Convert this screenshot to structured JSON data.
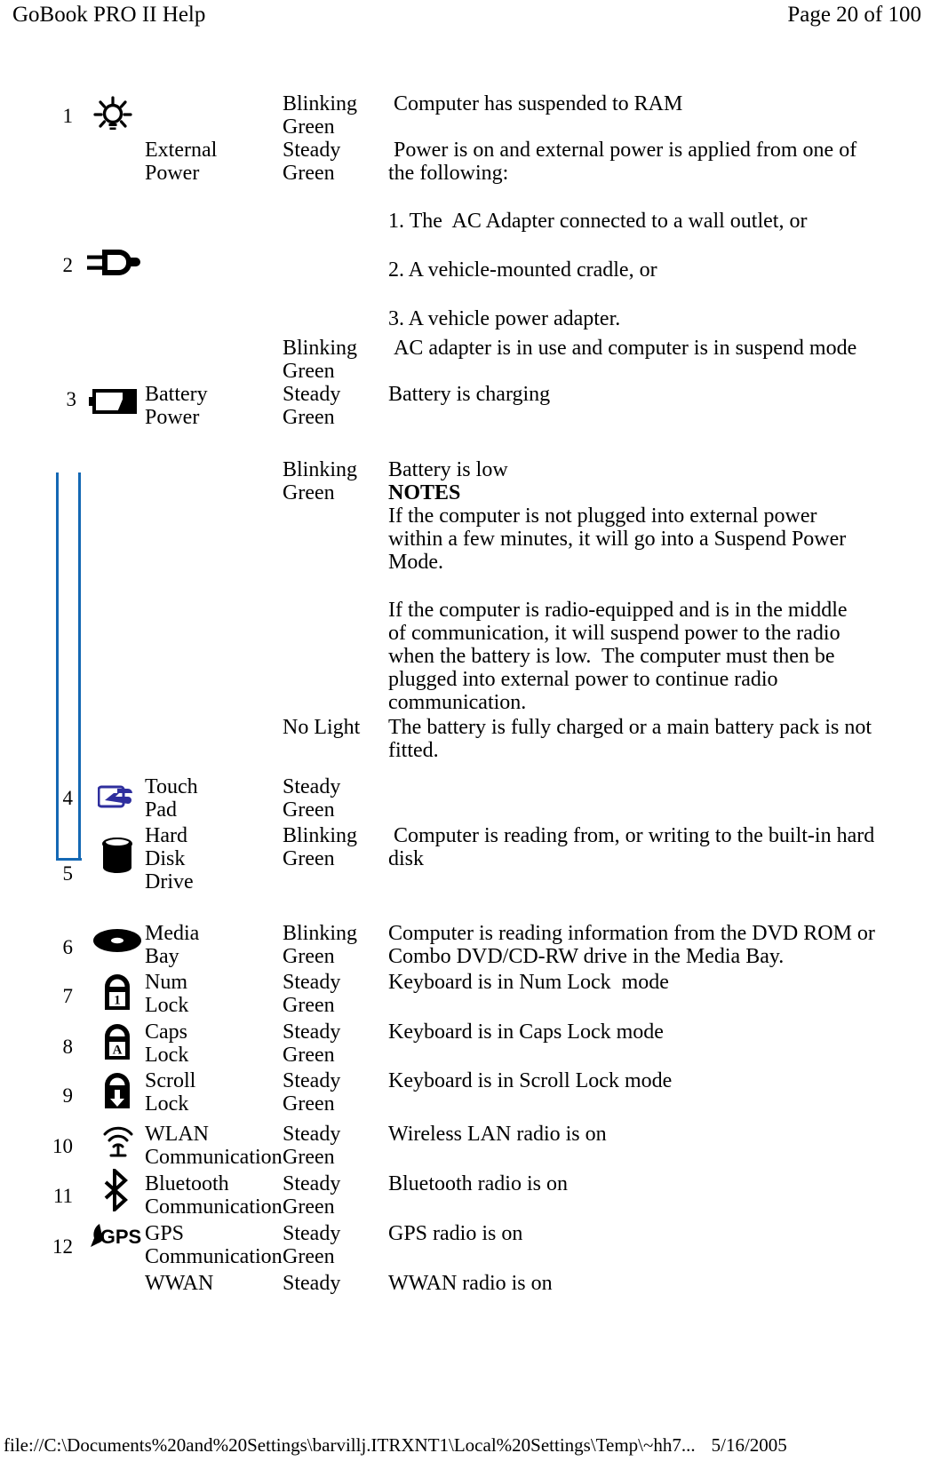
{
  "header": {
    "title": "GoBook PRO II Help",
    "page_label": "Page 20 of 100"
  },
  "footer": {
    "path": "file://C:\\Documents%20and%20Settings\\barvillj.ITRXNT1\\Local%20Settings\\Temp\\~hh7...",
    "date": "5/16/2005"
  },
  "table": {
    "rows": [
      {
        "number": "1",
        "icon": "power-light-icon",
        "label": "",
        "state": "Blinking\nGreen",
        "description": " Computer has suspended to RAM"
      },
      {
        "number": "",
        "icon": "",
        "label": "External\nPower",
        "state": "Steady\nGreen",
        "description": " Power is on and external power is applied from one of the following:"
      },
      {
        "number": "2",
        "icon": "power-plug-icon",
        "label": "",
        "state": "",
        "description": "1. The  AC Adapter connected to a wall outlet, or"
      },
      {
        "number": "",
        "icon": "",
        "label": "",
        "state": "",
        "description": "2. A vehicle-mounted cradle, or"
      },
      {
        "number": "",
        "icon": "",
        "label": "",
        "state": "",
        "description": "3. A vehicle power adapter."
      },
      {
        "number": "",
        "icon": "",
        "label": "",
        "state": "Blinking\nGreen",
        "description": " AC adapter is in use and computer is in suspend mode"
      },
      {
        "number": "3",
        "icon": "battery-icon",
        "label": "Battery\nPower",
        "state": "Steady\nGreen",
        "description": "Battery is charging"
      },
      {
        "number": "",
        "icon": "",
        "label": "",
        "state": "Blinking\nGreen",
        "description": "Battery is low"
      },
      {
        "number": "",
        "icon": "",
        "label": "",
        "state": "",
        "description": "NOTES",
        "bold": true
      },
      {
        "number": "",
        "icon": "",
        "label": "",
        "state": "",
        "description": "If the computer is not plugged into external power within a few minutes, it will go into a Suspend Power Mode."
      },
      {
        "number": "",
        "icon": "",
        "label": "",
        "state": "",
        "description": "If the computer is radio-equipped and is in the middle of communication, it will suspend power to the radio when the battery is low.  The computer must then be plugged into external power to continue radio communication."
      },
      {
        "number": "",
        "icon": "",
        "label": "",
        "state": "No Light",
        "description": "The battery is fully charged or a main battery pack is not fitted."
      },
      {
        "number": "4",
        "icon": "touchpad-icon",
        "label": "Touch\nPad",
        "state": "Steady\nGreen",
        "description": ""
      },
      {
        "number": "5",
        "icon": "hard-disk-icon",
        "label": "Hard\nDisk\nDrive",
        "state": "Blinking\nGreen",
        "description": " Computer is reading from, or writing to the built-in hard disk"
      },
      {
        "number": "6",
        "icon": "media-bay-disc-icon",
        "label": "Media\nBay",
        "state": "Blinking\nGreen",
        "description": "Computer is reading information from the DVD ROM or Combo DVD/CD-RW drive in the Media Bay."
      },
      {
        "number": "7",
        "icon": "num-lock-icon",
        "label": "Num\nLock",
        "state": "Steady\nGreen",
        "description": "Keyboard is in Num Lock  mode"
      },
      {
        "number": "8",
        "icon": "caps-lock-icon",
        "label": "Caps\nLock",
        "state": "Steady\nGreen",
        "description": "Keyboard is in Caps Lock mode"
      },
      {
        "number": "9",
        "icon": "scroll-lock-icon",
        "label": "Scroll\nLock",
        "state": "Steady\nGreen",
        "description": "Keyboard is in Scroll Lock mode"
      },
      {
        "number": "10",
        "icon": "wlan-icon",
        "label": "WLAN\nCommunication",
        "state": "Steady\nGreen",
        "description": "Wireless LAN radio is on"
      },
      {
        "number": "11",
        "icon": "bluetooth-icon",
        "label": "Bluetooth\nCommunication",
        "state": "Steady\nGreen",
        "description": "Bluetooth radio is on"
      },
      {
        "number": "12",
        "icon": "gps-icon",
        "label": "GPS\nCommunication",
        "state": "Steady\nGreen",
        "description": "GPS radio is on"
      },
      {
        "number": "",
        "icon": "",
        "label": "WWAN",
        "state": "Steady",
        "description": "WWAN radio is on"
      }
    ]
  },
  "colors": {
    "bracket_blue": "#1468b4",
    "touchpad_blue": "#2f2f9e",
    "text_black": "#000000"
  }
}
